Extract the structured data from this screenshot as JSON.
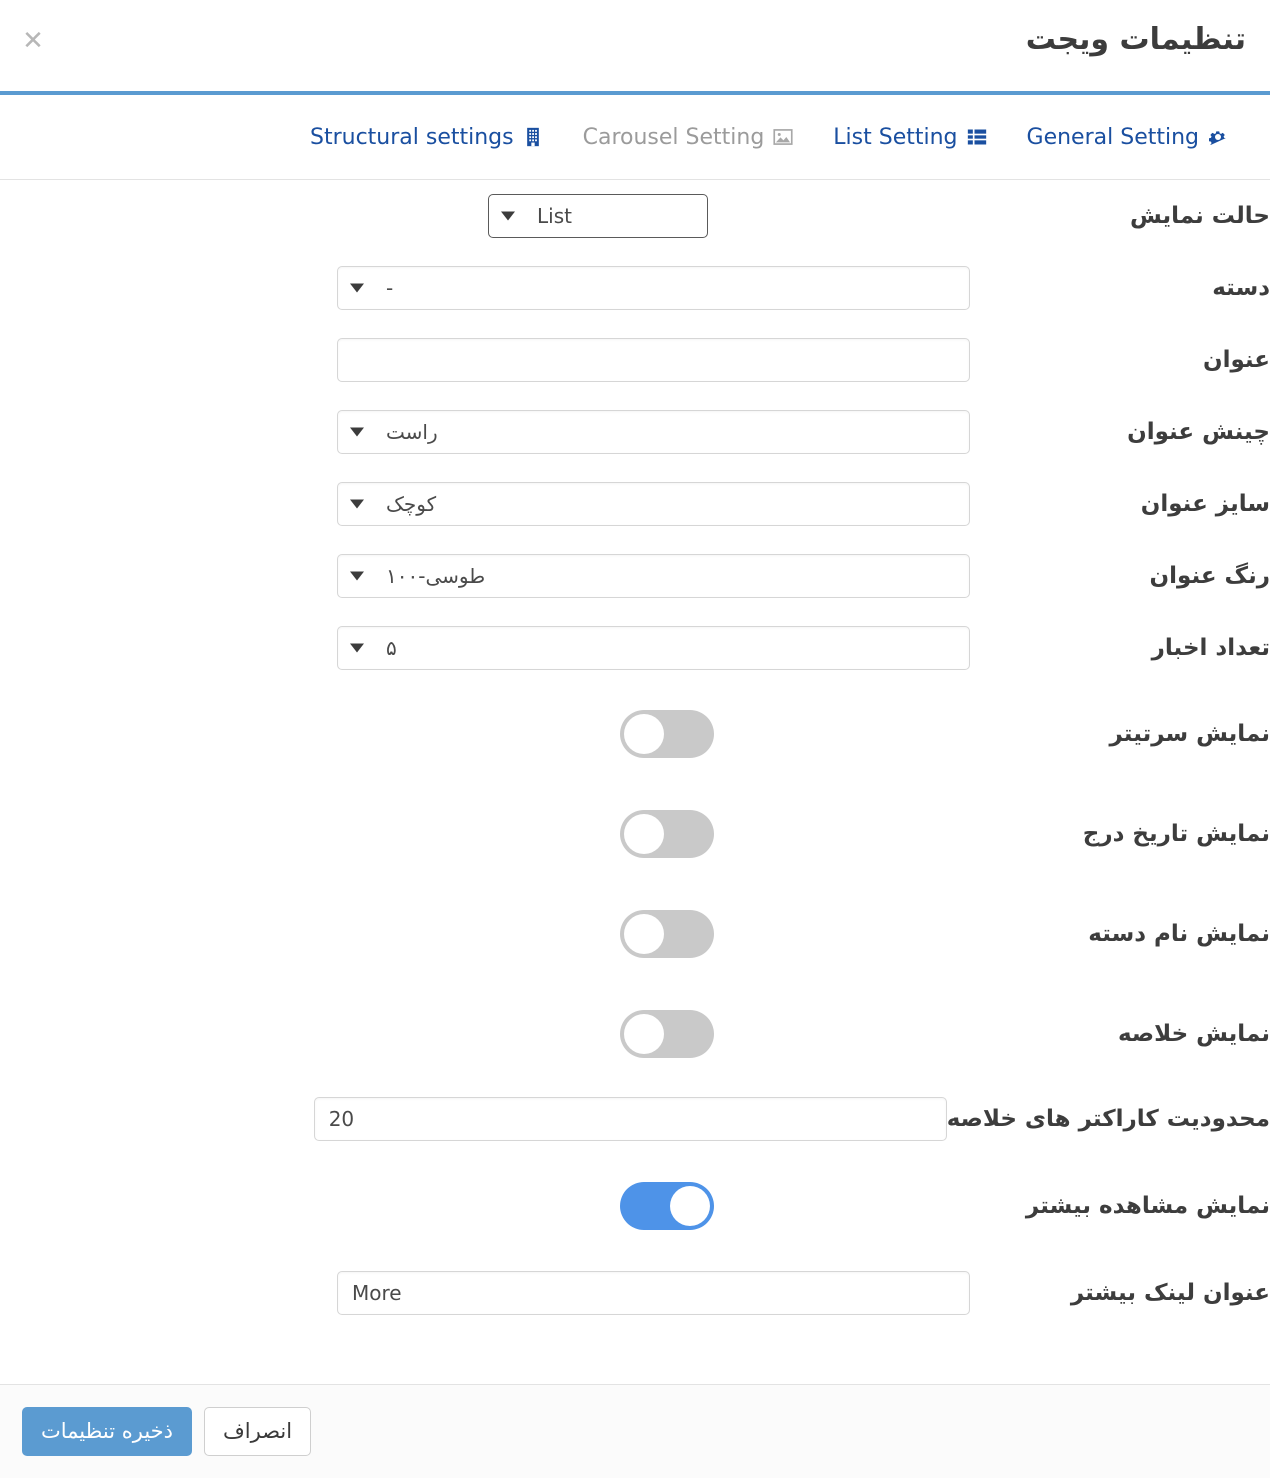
{
  "header": {
    "title": "تنظیمات ویجت",
    "close_label": "✕"
  },
  "tabs": [
    {
      "label": "General Setting",
      "icon": "gear-icon",
      "state": "active"
    },
    {
      "label": "List Setting",
      "icon": "list-icon",
      "state": "link"
    },
    {
      "label": "Carousel Setting",
      "icon": "image-icon",
      "state": "muted"
    },
    {
      "label": "Structural settings",
      "icon": "building-icon",
      "state": "link"
    }
  ],
  "fields": {
    "display_mode": {
      "label": "حالت نمایش",
      "value": "List"
    },
    "category": {
      "label": "دسته",
      "value": "-"
    },
    "title": {
      "label": "عنوان",
      "value": ""
    },
    "title_align": {
      "label": "چینش عنوان",
      "value": "راست"
    },
    "title_size": {
      "label": "سایز عنوان",
      "value": "کوچک"
    },
    "title_color": {
      "label": "رنگ عنوان",
      "value": "طوسی-۱۰۰"
    },
    "news_count": {
      "label": "تعداد اخبار",
      "value": "۵"
    },
    "show_headline": {
      "label": "نمایش سرتیتر",
      "value": "off"
    },
    "show_publish_date": {
      "label": "نمایش تاریخ درج",
      "value": "off"
    },
    "show_category_name": {
      "label": "نمایش نام دسته",
      "value": "off"
    },
    "show_summary": {
      "label": "نمایش خلاصه",
      "value": "off"
    },
    "summary_char_limit": {
      "label": "محدودیت کاراکتر های خلاصه",
      "value": "20"
    },
    "show_more": {
      "label": "نمایش مشاهده بیشتر",
      "value": "on"
    },
    "more_link_title": {
      "label": "عنوان لینک بیشتر",
      "value": "More"
    }
  },
  "footer": {
    "save_label": "ذخیره تنظیمات",
    "cancel_label": "انصراف"
  },
  "colors": {
    "accent": "#5b9bd1",
    "toggle_on": "#4e93e8",
    "toggle_off": "#c9c9c9",
    "tab_active": "#1a4fa0",
    "tab_muted": "#9b9b9b"
  }
}
